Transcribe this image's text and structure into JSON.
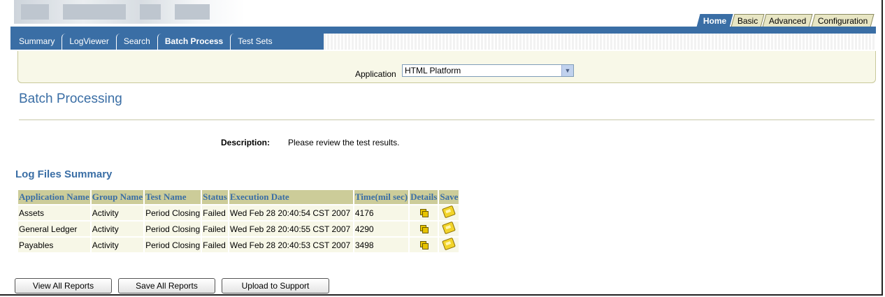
{
  "top_tabs": [
    {
      "label": "Home",
      "active": true
    },
    {
      "label": "Basic",
      "active": false
    },
    {
      "label": "Advanced",
      "active": false
    },
    {
      "label": "Configuration",
      "active": false
    }
  ],
  "sub_tabs": [
    {
      "label": "Summary",
      "active": false
    },
    {
      "label": "LogViewer",
      "active": false
    },
    {
      "label": "Search",
      "active": false
    },
    {
      "label": "Batch Process",
      "active": true
    },
    {
      "label": "Test Sets",
      "active": false
    }
  ],
  "application": {
    "label": "Application",
    "selected": "HTML Platform"
  },
  "page_title": "Batch Processing",
  "description": {
    "label": "Description:",
    "text": "Please review the test results."
  },
  "log_summary": {
    "title": "Log Files Summary",
    "columns": [
      "Application Name",
      "Group Name",
      "Test Name",
      "Status",
      "Execution Date",
      "Time(mil sec)",
      "Details",
      "Save"
    ],
    "rows": [
      [
        "Assets",
        "Activity",
        "Period Closing",
        "Failed",
        "Wed Feb 28 20:40:54 CST 2007",
        "4176"
      ],
      [
        "General Ledger",
        "Activity",
        "Period Closing",
        "Failed",
        "Wed Feb 28 20:40:55 CST 2007",
        "4290"
      ],
      [
        "Payables",
        "Activity",
        "Period Closing",
        "Failed",
        "Wed Feb 28 20:40:53 CST 2007",
        "3498"
      ]
    ]
  },
  "buttons": {
    "view_all": "View All Reports",
    "save_all": "Save All Reports",
    "upload": "Upload to Support"
  },
  "colors": {
    "brand_blue": "#3a6ea5",
    "header_tan": "#cccc99",
    "row_bg": "#f7f7e7"
  }
}
